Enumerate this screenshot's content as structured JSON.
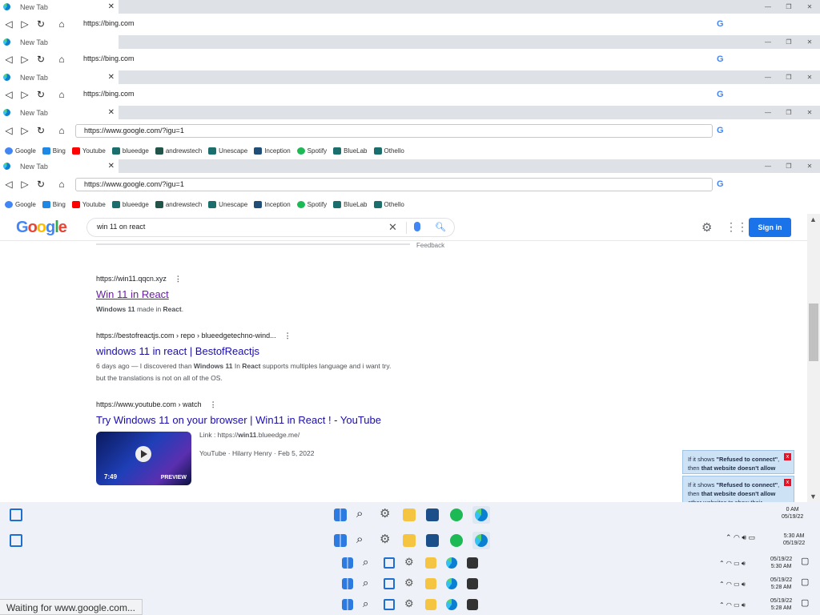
{
  "windows": [
    {
      "tab_title": "New Tab",
      "url": "https://bing.com"
    },
    {
      "tab_title": "New Tab",
      "url": "https://bing.com"
    },
    {
      "tab_title": "New Tab",
      "url": "https://bing.com"
    },
    {
      "tab_title": "New Tab",
      "url": "https://www.google.com/?igu=1"
    },
    {
      "tab_title": "New Tab",
      "url": "https://www.google.com/?igu=1"
    }
  ],
  "bookmarks": [
    {
      "label": "Google",
      "color": "#4285f4"
    },
    {
      "label": "Bing",
      "color": "#1e88e5"
    },
    {
      "label": "Youtube",
      "color": "#ff0000"
    },
    {
      "label": "blueedge",
      "color": "#1b6e6e"
    },
    {
      "label": "andrewstech",
      "color": "#22544a"
    },
    {
      "label": "Unescape",
      "color": "#1b6e6e"
    },
    {
      "label": "Inception",
      "color": "#1f4e79"
    },
    {
      "label": "Spotify",
      "color": "#1db954"
    },
    {
      "label": "BlueLab",
      "color": "#1b6e6e"
    },
    {
      "label": "Othello",
      "color": "#1b6e6e"
    }
  ],
  "google": {
    "logo": "Google",
    "query": "win 11 on react",
    "sign_in": "Sign in",
    "feedback": "Feedback",
    "results": [
      {
        "url": "https://win11.qqcn.xyz",
        "title": "Win 11 in React",
        "snippet_html": "<b>Windows 11</b> made in <b>React</b>."
      },
      {
        "url": "https://bestofreactjs.com › repo › blueedgetechno-wind...",
        "title": "windows 11 in react | BestofReactjs",
        "snippet_html": "6 days ago — I discovered than <b>Windows 11</b> In <b>React</b> supports multiples language and i want try.<br>but the translations is not on all of the OS."
      },
      {
        "url": "https://www.youtube.com › watch",
        "title": "Try Windows 11 on your browser | Win11 in React ! - YouTube"
      }
    ],
    "video": {
      "duration": "7:49",
      "preview": "PREVIEW",
      "link_html": "Link : https://<b>win11</b>.blueedge.me/",
      "meta": "YouTube · Hilarry Henry · Feb 5, 2022"
    }
  },
  "toasts": [
    {
      "html": "If it shows <b>\"Refused to connect\"</b>, then <b>that website doesn't allow</b>"
    },
    {
      "html": "If it shows <b>\"Refused to connect\"</b>, then <b>that website doesn't allow</b> other websites to show their content. I <b>cannot fix it</b>."
    }
  ],
  "clock": {
    "t1": "5:30 AM",
    "d1": "05/19/22",
    "t2": "5:30 AM",
    "d2": "05/19/22",
    "t3": "5:28 AM",
    "d3": "05/19/22",
    "t4": "5:28 AM",
    "d4": "05/19/22",
    "partial_time": "0 AM",
    "partial_date": "05/19/22"
  },
  "status": "Waiting for www.google.com..."
}
